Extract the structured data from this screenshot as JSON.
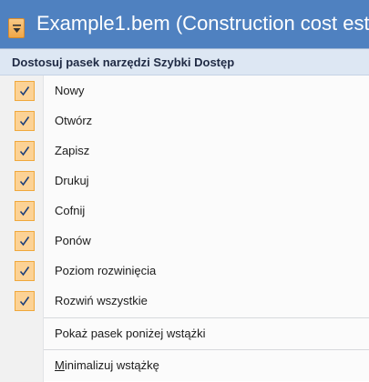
{
  "window": {
    "title": "Example1.bem (Construction cost est",
    "colors": {
      "titlebar": "#4f81c0",
      "qat_button": "#f0a748",
      "check_bg": "#fcd295"
    },
    "qat_icon": "dropdown-arrow-icon"
  },
  "menu": {
    "header": "Dostosuj pasek narzędzi Szybki Dostęp",
    "check_icon": "checkmark-icon",
    "items": [
      {
        "label": "Nowy",
        "checked": true
      },
      {
        "label": "Otwórz",
        "checked": true
      },
      {
        "label": "Zapisz",
        "checked": true
      },
      {
        "label": "Drukuj",
        "checked": true
      },
      {
        "label": "Cofnij",
        "checked": true
      },
      {
        "label": "Ponów",
        "checked": true
      },
      {
        "label": "Poziom rozwinięcia",
        "checked": true
      },
      {
        "label": "Rozwiń wszystkie",
        "checked": true
      }
    ],
    "show_below": "Pokaż pasek poniżej wstążki",
    "minimize_first": "M",
    "minimize_rest": "inimalizuj wstążkę"
  }
}
